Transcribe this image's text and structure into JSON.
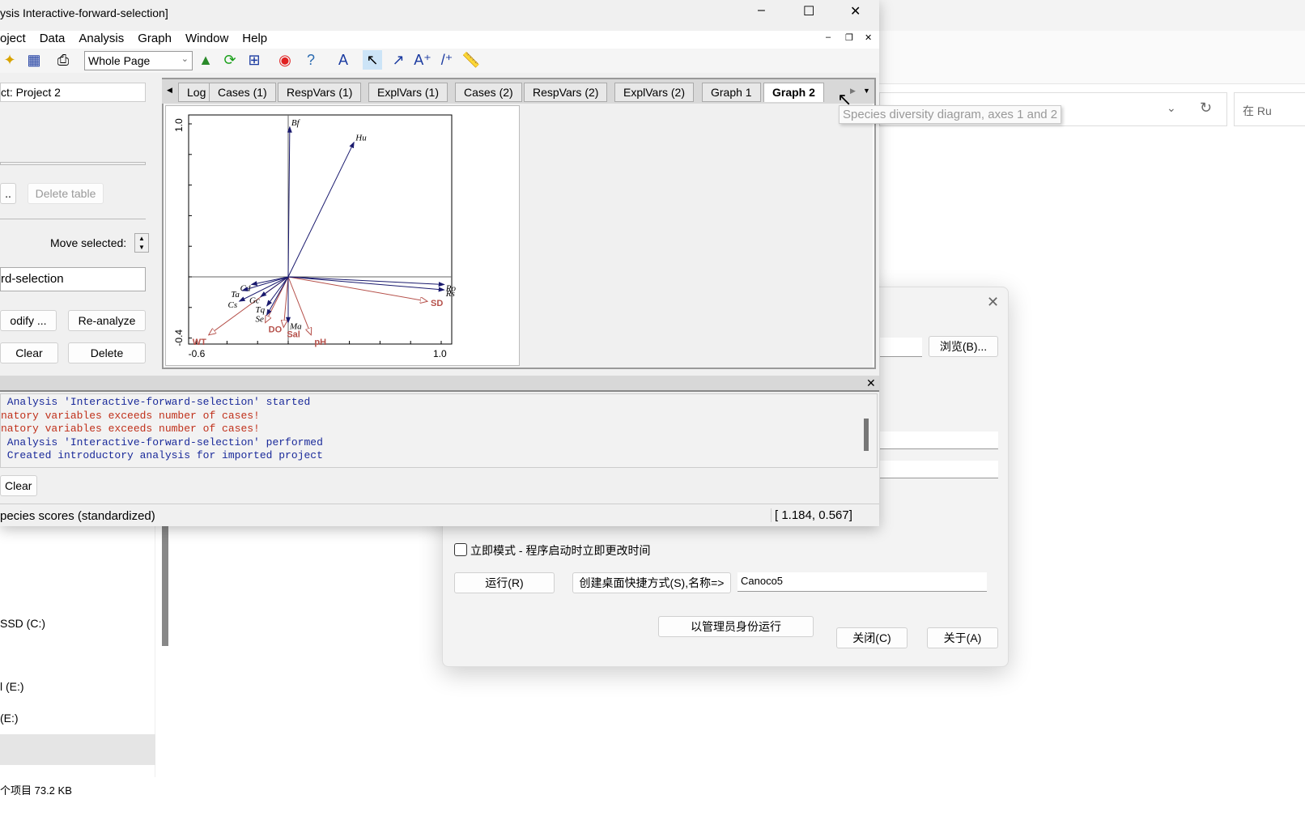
{
  "window": {
    "title": "ysis Interactive-forward-selection]",
    "controls": {
      "minimize": "–",
      "maximize": "☐",
      "close": "✕"
    }
  },
  "menu": [
    "oject",
    "Data",
    "Analysis",
    "Graph",
    "Window",
    "Help"
  ],
  "toolbar": {
    "zoom_select": "Whole Page"
  },
  "left_panel": {
    "project_label": "ct: Project 2",
    "browse_button": "..",
    "delete_table": "Delete table",
    "move_selected": "Move selected:",
    "analysis_name": "rd-selection",
    "modify": "odify ...",
    "reanalyze": "Re-analyze",
    "clear": "Clear",
    "delete": "Delete"
  },
  "tabs": [
    "Log",
    "Cases (1)",
    "RespVars (1)",
    "ExplVars (1)",
    "Cases (2)",
    "RespVars (2)",
    "ExplVars (2)",
    "Graph 1",
    "Graph 2"
  ],
  "active_tab": "Graph 2",
  "tooltip": "Species diversity diagram, axes 1 and 2",
  "chart_data": {
    "type": "biplot",
    "xlim": [
      -0.6,
      1.0
    ],
    "ylim": [
      -0.4,
      1.0
    ],
    "x_tick_labels": [
      "-0.6",
      "1.0"
    ],
    "y_tick_labels": [
      "-0.4",
      "1.0"
    ],
    "species": [
      {
        "name": "Bf",
        "x": 0.01,
        "y": 0.98
      },
      {
        "name": "Hu",
        "x": 0.43,
        "y": 0.88
      },
      {
        "name": "Ro",
        "x": 1.02,
        "y": -0.05
      },
      {
        "name": "Rs",
        "x": 1.02,
        "y": -0.085
      },
      {
        "name": "Cd",
        "x": -0.24,
        "y": -0.05
      },
      {
        "name": "Ta",
        "x": -0.3,
        "y": -0.09
      },
      {
        "name": "Gc",
        "x": -0.18,
        "y": -0.13
      },
      {
        "name": "Cs",
        "x": -0.32,
        "y": -0.16
      },
      {
        "name": "Tq",
        "x": -0.14,
        "y": -0.19
      },
      {
        "name": "Se",
        "x": -0.14,
        "y": -0.25
      },
      {
        "name": "Ma",
        "x": 0.0,
        "y": -0.3
      }
    ],
    "env": [
      {
        "name": "SD",
        "x": 0.91,
        "y": -0.16
      },
      {
        "name": "WT",
        "x": -0.52,
        "y": -0.38
      },
      {
        "name": "DO",
        "x": -0.15,
        "y": -0.3
      },
      {
        "name": "Sal",
        "x": -0.03,
        "y": -0.33
      },
      {
        "name": "pH",
        "x": 0.15,
        "y": -0.38
      }
    ],
    "colors": {
      "species": "#1a1a6e",
      "env": "#b5504a"
    }
  },
  "log": {
    "lines": [
      {
        "text": " Analysis 'Interactive-forward-selection' started",
        "color": "#1a2a9a"
      },
      {
        "text": "natory variables exceeds number of cases!",
        "color": "#c0301a"
      },
      {
        "text": "natory variables exceeds number of cases!",
        "color": "#c0301a"
      },
      {
        "text": " Analysis 'Interactive-forward-selection' performed",
        "color": "#1a2a9a"
      },
      {
        "text": " Created introductory analysis for imported project",
        "color": "#1a2a9a"
      }
    ],
    "clear": "Clear"
  },
  "status": {
    "left": "pecies scores (standardized)",
    "coords": "[ 1.184, 0.567]"
  },
  "dialog": {
    "browse": "浏览(B)...",
    "checkbox_label": "立即模式 - 程序启动时立即更改时间",
    "run": "运行(R)",
    "shortcut": "创建桌面快捷方式(S),名称=>",
    "shortcut_name": "Canoco5",
    "run_admin": "以管理员身份运行",
    "close": "关闭(C)",
    "about": "关于(A)"
  },
  "explorer": {
    "search": "在 Ru",
    "drives": [
      "SSD (C:)",
      "l (E:)",
      "(E:)"
    ],
    "footer": "个项目 73.2 KB"
  }
}
